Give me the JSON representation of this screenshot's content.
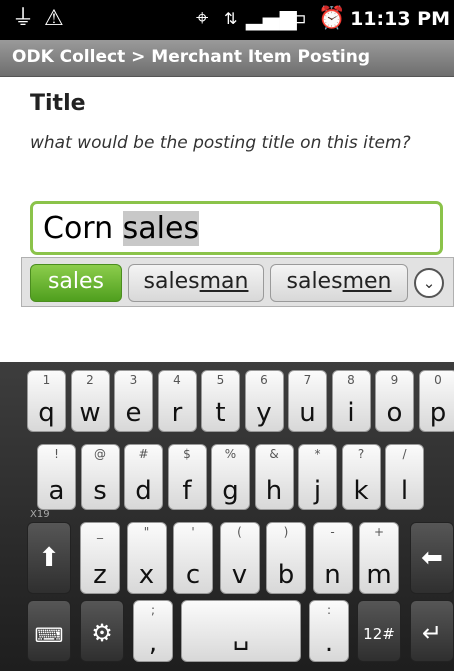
{
  "status": {
    "time": "11:13 PM",
    "icons": [
      "usb-debug-icon",
      "warning-icon",
      "gps-icon",
      "data-transfer-icon",
      "signal-icon",
      "battery-charging-icon",
      "alarm-icon"
    ]
  },
  "titlebar": {
    "title": "ODK Collect > Merchant Item Posting"
  },
  "question": {
    "title": "Title",
    "hint": "what would be the posting title on this item?",
    "value_prefix": "Corn ",
    "value_selected": "sales"
  },
  "suggestions": [
    {
      "label": "sales",
      "active": true
    },
    {
      "label_plain": "sales",
      "label_underlined": "man",
      "active": false
    },
    {
      "label_plain": "sales",
      "label_underlined": "men",
      "active": false
    }
  ],
  "keyboard": {
    "row1": [
      {
        "alt": "1",
        "main": "q"
      },
      {
        "alt": "2",
        "main": "w"
      },
      {
        "alt": "3",
        "main": "e"
      },
      {
        "alt": "4",
        "main": "r"
      },
      {
        "alt": "5",
        "main": "t"
      },
      {
        "alt": "6",
        "main": "y"
      },
      {
        "alt": "7",
        "main": "u"
      },
      {
        "alt": "8",
        "main": "i"
      },
      {
        "alt": "9",
        "main": "o"
      },
      {
        "alt": "0",
        "main": "p"
      }
    ],
    "row2": [
      {
        "alt": "!",
        "main": "a"
      },
      {
        "alt": "@",
        "main": "s"
      },
      {
        "alt": "#",
        "main": "d"
      },
      {
        "alt": "$",
        "main": "f"
      },
      {
        "alt": "%",
        "main": "g"
      },
      {
        "alt": "&",
        "main": "h"
      },
      {
        "alt": "*",
        "main": "j"
      },
      {
        "alt": "?",
        "main": "k"
      },
      {
        "alt": "/",
        "main": "l"
      }
    ],
    "row3": [
      {
        "alt": "_",
        "main": "z"
      },
      {
        "alt": "\"",
        "main": "x"
      },
      {
        "alt": "'",
        "main": "c"
      },
      {
        "alt": "(",
        "main": "v"
      },
      {
        "alt": ")",
        "main": "b"
      },
      {
        "alt": "-",
        "main": "n"
      },
      {
        "alt": "+",
        "main": "m"
      }
    ],
    "row4_comma_alt": ";",
    "row4_comma": ",",
    "row4_period_alt": ":",
    "row4_period": ".",
    "num_label": "12#",
    "small_label": "X19"
  },
  "colors": {
    "accent": "#8bc34a",
    "suggest_active": "#5faa2a"
  }
}
